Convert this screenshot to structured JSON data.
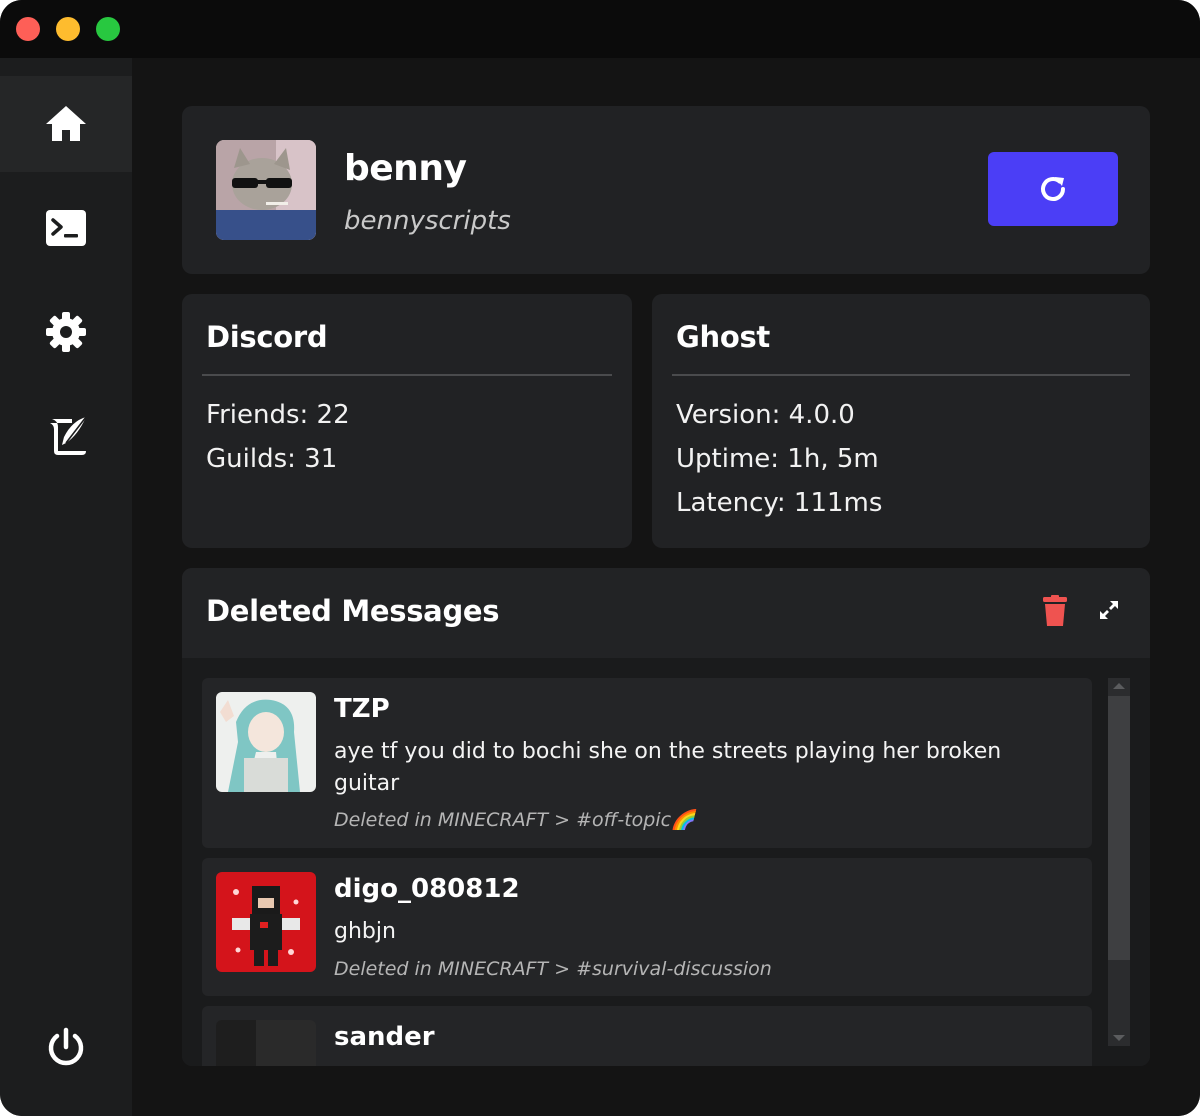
{
  "window": {
    "controls": [
      "close",
      "minimize",
      "maximize"
    ]
  },
  "sidebar": {
    "items": [
      {
        "name": "home",
        "icon": "home-icon",
        "active": true
      },
      {
        "name": "console",
        "icon": "terminal-icon",
        "active": false
      },
      {
        "name": "settings",
        "icon": "gear-icon",
        "active": false
      },
      {
        "name": "scripts",
        "icon": "scroll-quill-icon",
        "active": false
      }
    ],
    "power_icon": "power-icon"
  },
  "profile": {
    "display_name": "benny",
    "username": "bennyscripts",
    "refresh_icon": "refresh-icon",
    "refresh_color": "#4b3ef6"
  },
  "discord": {
    "title": "Discord",
    "friends": "Friends: 22",
    "guilds": "Guilds: 31"
  },
  "ghost": {
    "title": "Ghost",
    "version": "Version: 4.0.0",
    "uptime": "Uptime: 1h, 5m",
    "latency": "Latency: 111ms"
  },
  "deleted_messages": {
    "title": "Deleted Messages",
    "trash_icon": "trash-icon",
    "trash_color": "#ef5350",
    "expand_icon": "expand-icon",
    "messages": [
      {
        "author": "TZP",
        "content": "aye tf you did to bochi she on the streets playing her broken guitar",
        "location": "Deleted in MINECRAFT > #off-topic🌈"
      },
      {
        "author": "digo_080812",
        "content": "ghbjn",
        "location": "Deleted in MINECRAFT > #survival-discussion"
      },
      {
        "author": "sander",
        "content": "",
        "location": ""
      }
    ]
  }
}
